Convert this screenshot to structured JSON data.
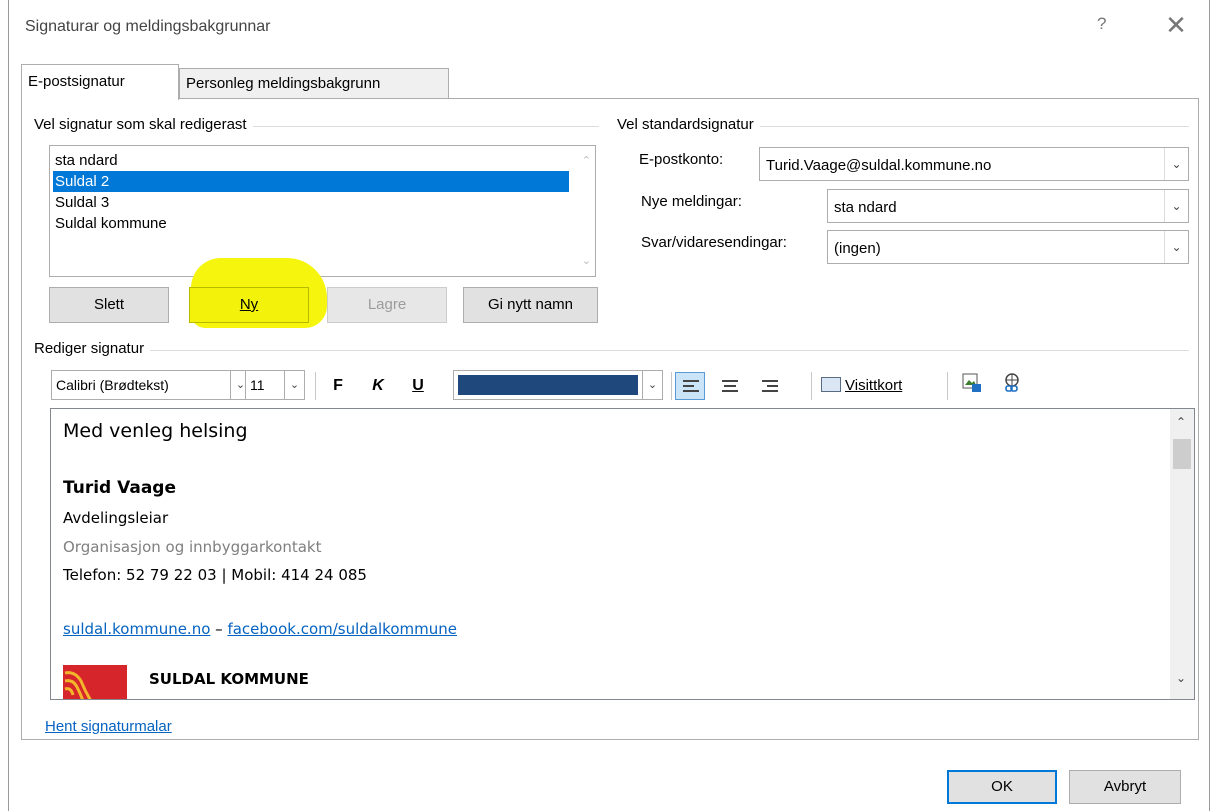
{
  "window": {
    "title": "Signaturar og meldingsbakgrunnar",
    "help": "?",
    "close": "✕"
  },
  "tabs": [
    {
      "label": "E-postsignatur"
    },
    {
      "label": "Personleg meldingsbakgrunn"
    }
  ],
  "select_group": {
    "label": "Vel signatur som skal redigerast",
    "items": [
      "sta ndard",
      "Suldal 2",
      "Suldal 3",
      "Suldal kommune"
    ],
    "selected_index": 1
  },
  "buttons": {
    "delete": "Slett",
    "new": "Ny",
    "save": "Lagre",
    "rename": "Gi nytt namn"
  },
  "default_group": {
    "label": "Vel standardsignatur",
    "account_label": "E-postkonto:",
    "account_value": "Turid.Vaage@suldal.kommune.no",
    "new_label": "Nye meldingar:",
    "new_value": "sta ndard",
    "reply_label": "Svar/vidaresendingar:",
    "reply_value": "(ingen)"
  },
  "edit_group": {
    "label": "Rediger signatur"
  },
  "toolbar": {
    "font": "Calibri (Brødtekst)",
    "size": "11",
    "bold": "F",
    "italic": "K",
    "underline": "U",
    "color": "#1f497d",
    "business_card": "Visittkort"
  },
  "signature": {
    "greeting": "Med venleg helsing",
    "name": "Turid Vaage",
    "role": "Avdelingsleiar",
    "department": "Organisasjon og innbyggarkontakt",
    "phone_line": "Telefon: 52 79 22 03  |  Mobil: 414 24 085",
    "link1": "suldal.kommune.no",
    "dash": " – ",
    "link2": "facebook.com/suldalkommune",
    "org": "SULDAL KOMMUNE"
  },
  "footer": {
    "templates_link": "Hent signaturmalar",
    "ok": "OK",
    "cancel": "Avbryt"
  }
}
